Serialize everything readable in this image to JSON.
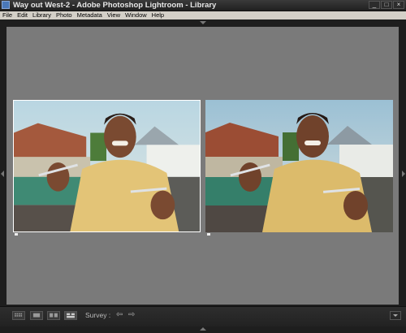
{
  "window": {
    "title": "Way out West-2 - Adobe Photoshop Lightroom - Library",
    "app_icon": "lightroom-icon",
    "controls": [
      "minimize-icon",
      "maximize-icon",
      "close-icon"
    ]
  },
  "menubar": {
    "items": [
      {
        "label": "File"
      },
      {
        "label": "Edit"
      },
      {
        "label": "Library"
      },
      {
        "label": "Photo"
      },
      {
        "label": "Metadata"
      },
      {
        "label": "View"
      },
      {
        "label": "Window"
      },
      {
        "label": "Help"
      }
    ]
  },
  "photos": [
    {
      "state": "selected"
    },
    {
      "state": "candidate"
    }
  ],
  "toolbar": {
    "view_modes": [
      "grid-view-icon",
      "loupe-view-icon",
      "compare-view-icon",
      "survey-view-icon"
    ],
    "survey_label": "Survey :",
    "prev_icon": "left-arrow-icon",
    "next_icon": "right-arrow-icon"
  },
  "colors": {
    "background": "#7a7a7a",
    "chrome": "#1e1e1e",
    "menubar": "#d4d0c8"
  }
}
